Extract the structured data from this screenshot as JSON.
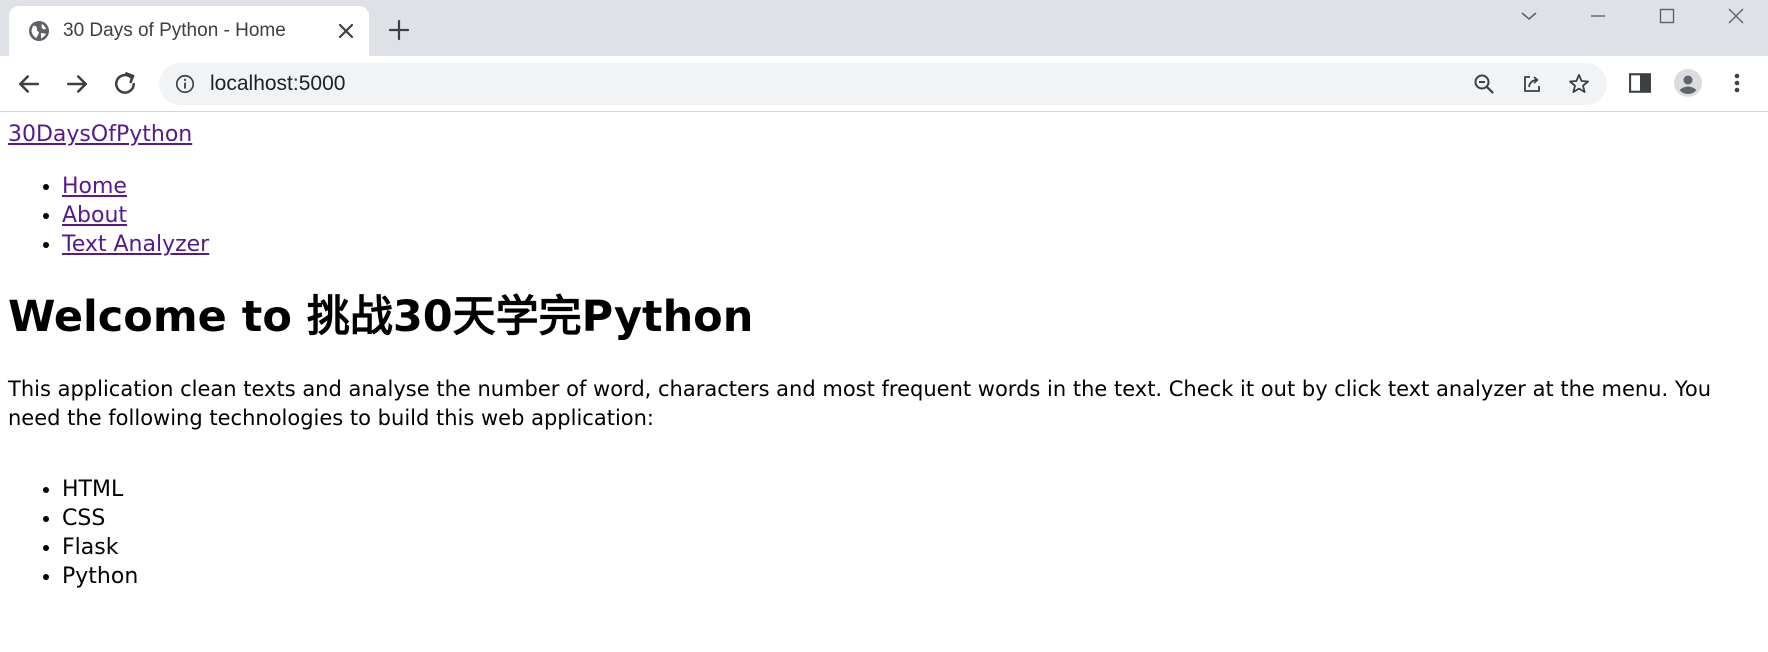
{
  "browser": {
    "tab_title": "30 Days of Python - Home",
    "url": "localhost:5000",
    "icons": {
      "favicon": "globe-icon",
      "tab_close": "close-icon",
      "new_tab": "plus-icon",
      "back": "arrow-left-icon",
      "forward": "arrow-right-icon",
      "reload": "reload-icon",
      "site_info": "info-icon",
      "zoom": "zoom-out-icon",
      "share": "share-icon",
      "bookmark": "star-icon",
      "side_panel": "side-panel-icon",
      "profile": "avatar-icon",
      "menu": "more-vertical-icon"
    }
  },
  "page": {
    "brand": "30DaysOfPython",
    "nav": [
      {
        "label": "Home"
      },
      {
        "label": "About"
      },
      {
        "label": "Text Analyzer"
      }
    ],
    "heading": "Welcome to 挑战30天学完Python",
    "intro": "This application clean texts and analyse the number of word, characters and most frequent words in the text. Check it out by click text analyzer at the menu. You need the following technologies to build this web application:",
    "technologies": [
      "HTML",
      "CSS",
      "Flask",
      "Python"
    ]
  },
  "colors": {
    "tab_strip": "#dee1e6",
    "omnibox": "#f1f3f4",
    "visited_link": "#551a8b"
  }
}
